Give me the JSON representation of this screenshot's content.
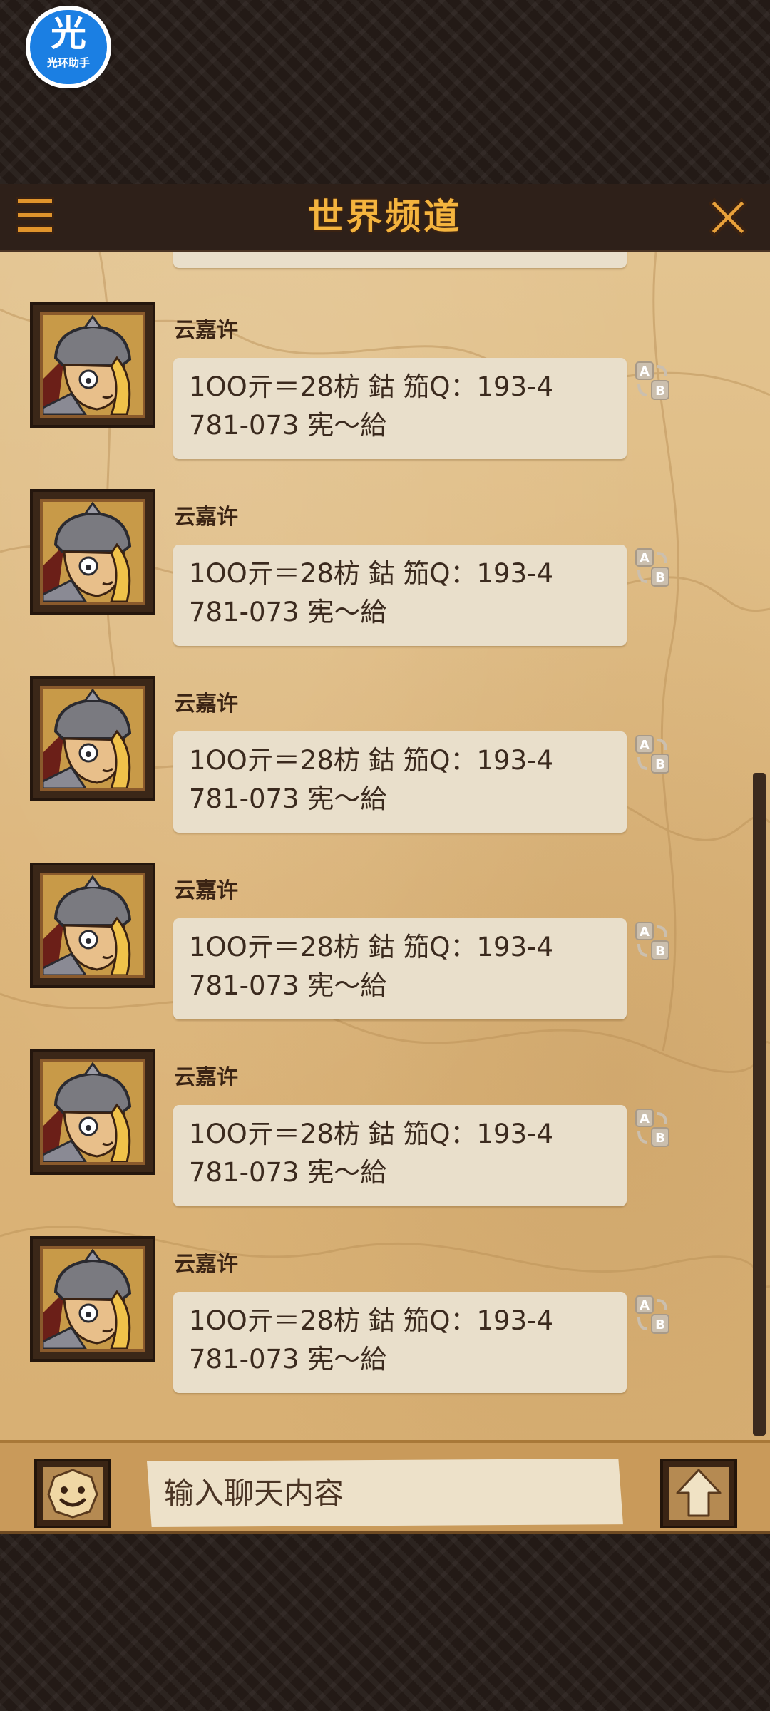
{
  "app_badge": {
    "glyph": "光",
    "name": "光环助手"
  },
  "header": {
    "title": "世界频道"
  },
  "messages": [
    {
      "sender": "云嘉许",
      "line1": "1OO亓＝28枋 鈷 笳Q：193-4",
      "line2": "781-073 宪～給"
    },
    {
      "sender": "云嘉许",
      "line1": "1OO亓＝28枋 鈷 笳Q：193-4",
      "line2": "781-073 宪～給"
    },
    {
      "sender": "云嘉许",
      "line1": "1OO亓＝28枋 鈷 笳Q：193-4",
      "line2": "781-073 宪～給"
    },
    {
      "sender": "云嘉许",
      "line1": "1OO亓＝28枋 鈷 笳Q：193-4",
      "line2": "781-073 宪～給"
    },
    {
      "sender": "云嘉许",
      "line1": "1OO亓＝28枋 鈷 笳Q：193-4",
      "line2": "781-073 宪～給"
    },
    {
      "sender": "云嘉许",
      "line1": "1OO亓＝28枋 鈷 笳Q：193-4",
      "line2": "781-073 宪～給"
    }
  ],
  "input": {
    "placeholder": "输入聊天内容"
  },
  "icons": {
    "menu": "menu-icon",
    "close": "close-icon",
    "translate": "translate-icon",
    "emoji": "emoji-icon",
    "send": "send-arrow-icon"
  },
  "colors": {
    "title": "#f4b43e",
    "header_bg": "#2e2019",
    "parchment": "#dcb57a",
    "bubble": "#e9dfcb",
    "input_bar": "#c99a5a"
  }
}
